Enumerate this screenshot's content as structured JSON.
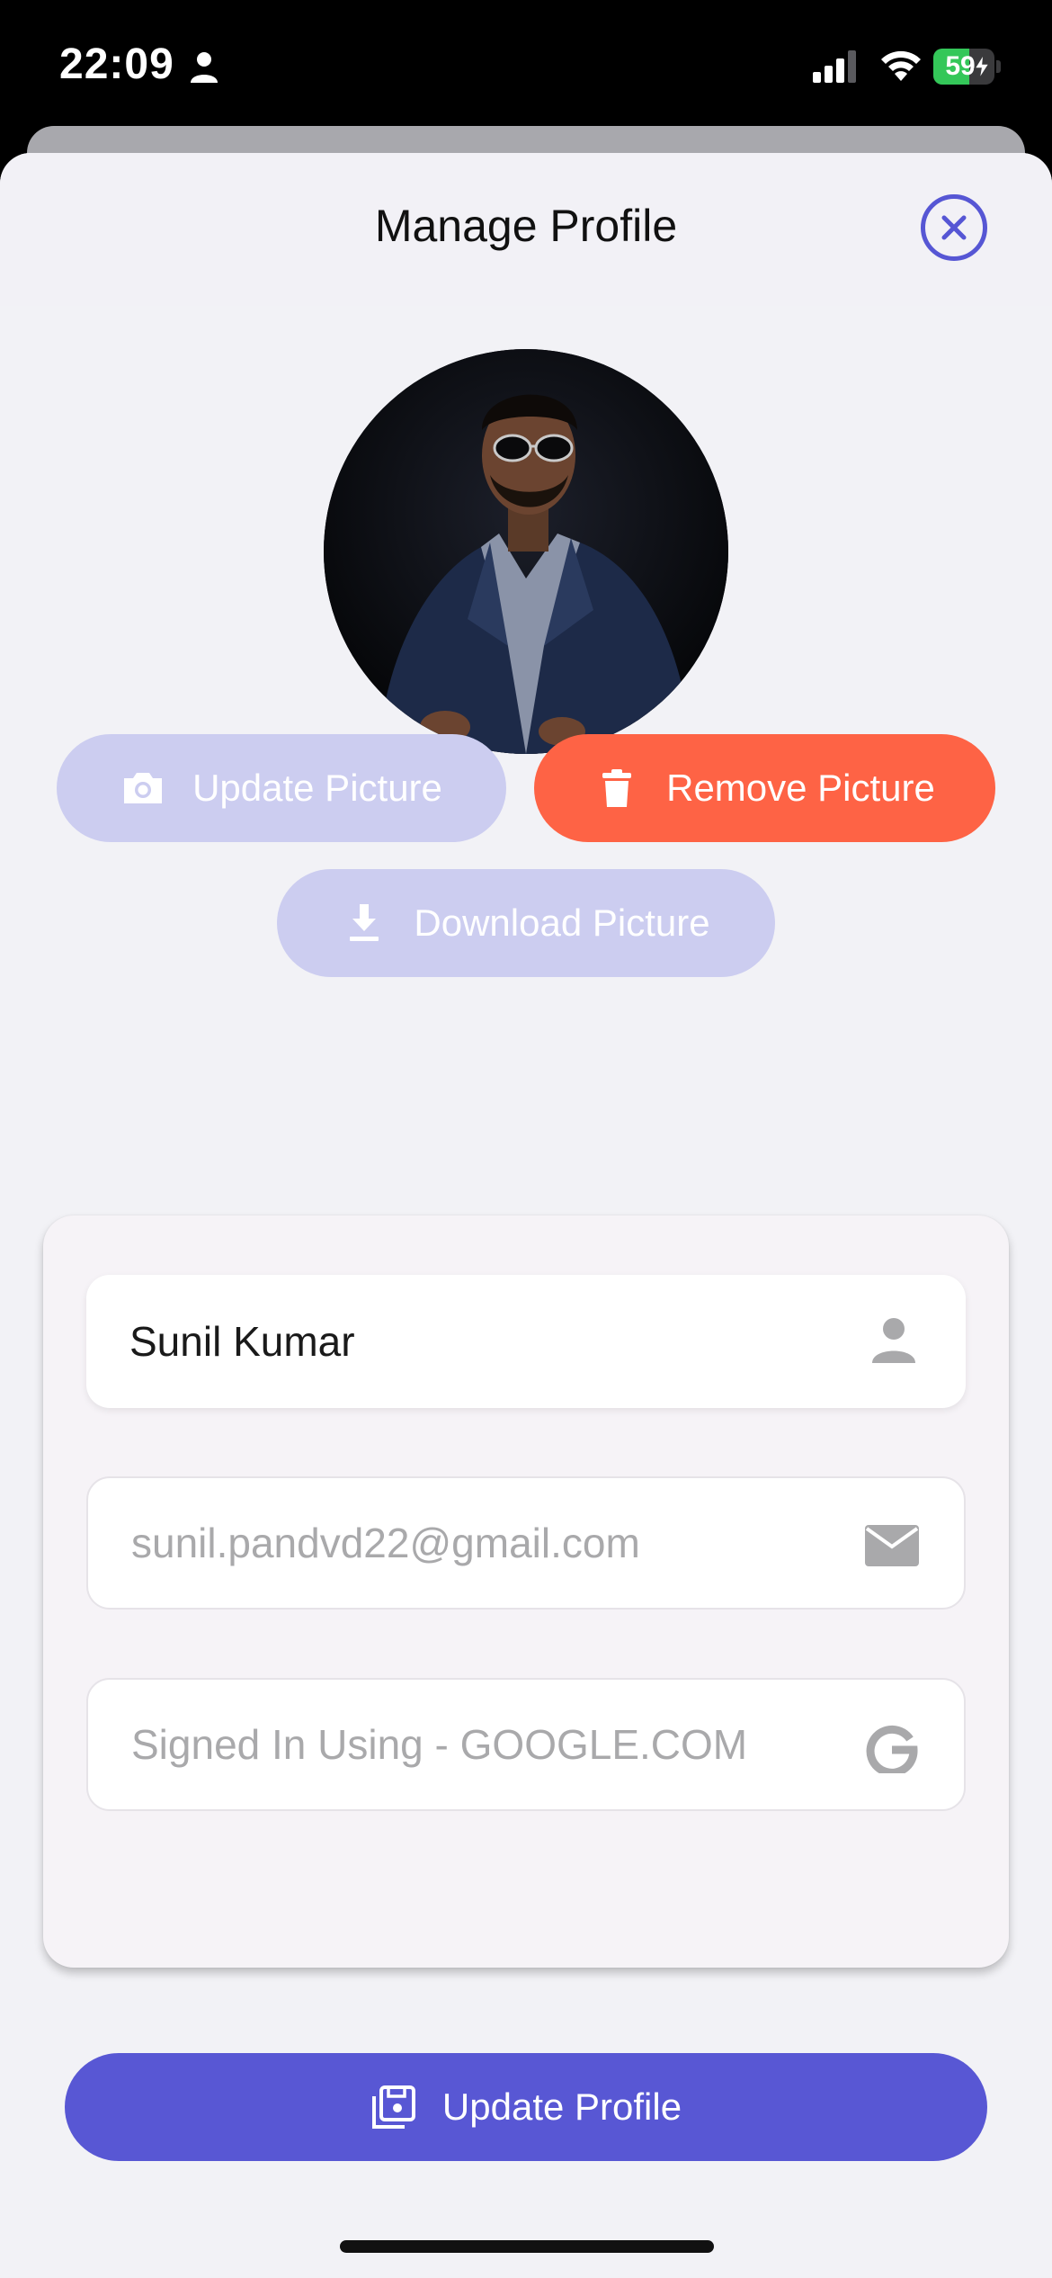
{
  "status_bar": {
    "time": "22:09",
    "battery_level": "59",
    "battery_fraction": 0.59,
    "icons": [
      "person-icon",
      "cellular-signal-icon",
      "wifi-icon",
      "battery-charging-icon"
    ]
  },
  "header": {
    "title": "Manage Profile",
    "close_icon": "close-circle-icon"
  },
  "avatar": {
    "icon": "profile-photo"
  },
  "picture_actions": {
    "update_label": "Update Picture",
    "update_icon": "camera-icon",
    "remove_label": "Remove Picture",
    "remove_icon": "trash-icon",
    "download_label": "Download Picture",
    "download_icon": "download-icon"
  },
  "form": {
    "name_value": "Sunil Kumar",
    "name_icon": "person-icon",
    "email_value": "sunil.pandvd22@gmail.com",
    "email_icon": "mail-icon",
    "provider_value": "Signed In Using - GOOGLE.COM",
    "provider_icon": "google-icon",
    "submit_label": "Update Profile",
    "submit_icon": "save-icon"
  },
  "colors": {
    "accent": "#5857d4",
    "danger": "#fe6345",
    "disabled": "#cccdf0",
    "background": "#f2f2f6",
    "battery": "#34c759"
  }
}
